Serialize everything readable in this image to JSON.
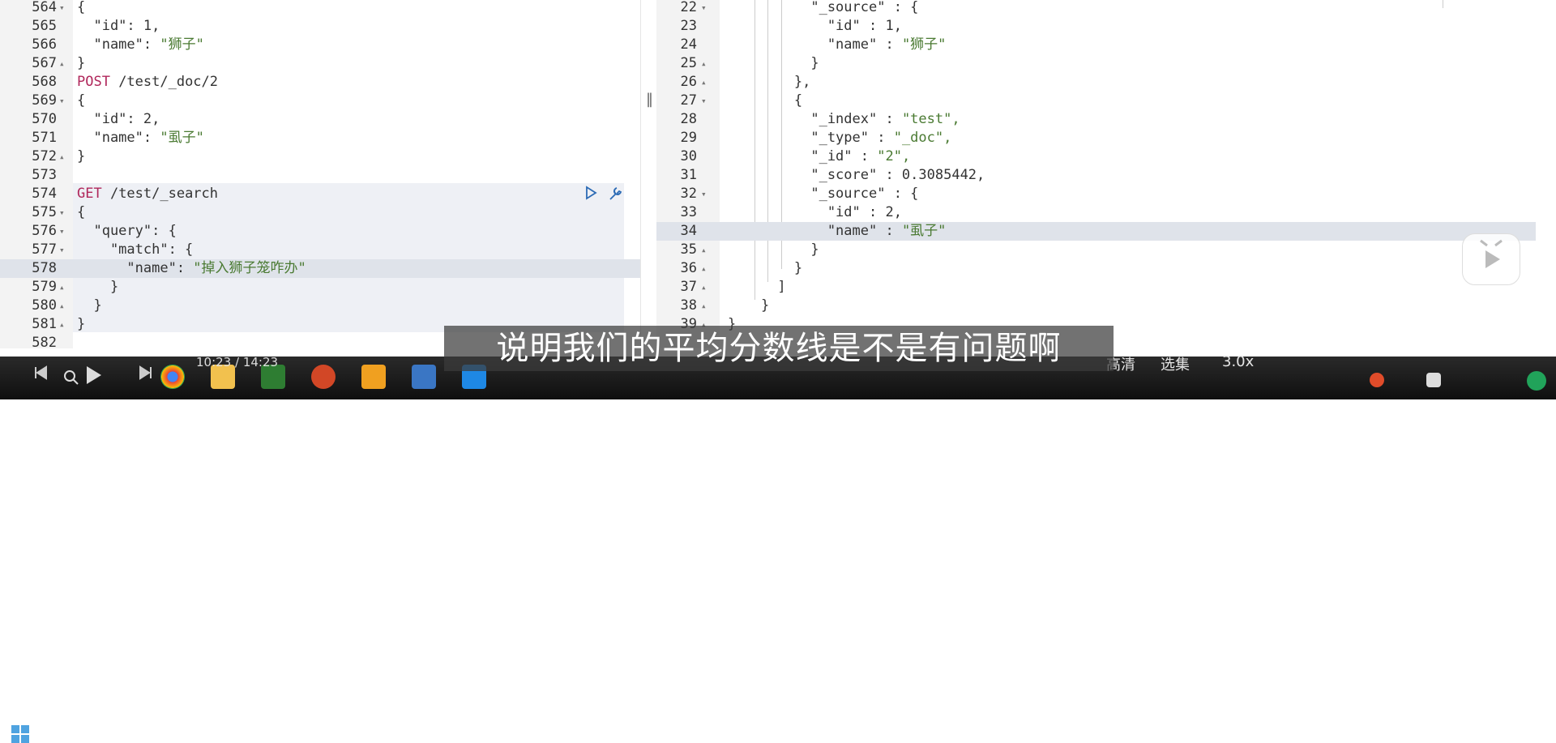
{
  "left_editor": {
    "lines": [
      {
        "num": "564",
        "fold": "▾",
        "code": "{"
      },
      {
        "num": "565",
        "fold": "",
        "code": "  \"id\": 1,"
      },
      {
        "num": "566",
        "fold": "",
        "code": "  \"name\": \"狮子\""
      },
      {
        "num": "567",
        "fold": "▴",
        "code": "}"
      },
      {
        "num": "568",
        "fold": "",
        "method": "POST",
        "url": " /test/_doc/2"
      },
      {
        "num": "569",
        "fold": "▾",
        "code": "{"
      },
      {
        "num": "570",
        "fold": "",
        "code": "  \"id\": 2,"
      },
      {
        "num": "571",
        "fold": "",
        "code": "  \"name\": \"虱子\""
      },
      {
        "num": "572",
        "fold": "▴",
        "code": "}"
      },
      {
        "num": "573",
        "fold": "",
        "code": ""
      },
      {
        "num": "574",
        "fold": "",
        "method": "GET",
        "url": " /test/_search"
      },
      {
        "num": "575",
        "fold": "▾",
        "code": "{"
      },
      {
        "num": "576",
        "fold": "▾",
        "code": "  \"query\": {"
      },
      {
        "num": "577",
        "fold": "▾",
        "code": "    \"match\": {"
      },
      {
        "num": "578",
        "fold": "",
        "code": "      \"name\": \"掉入狮子笼咋办\""
      },
      {
        "num": "579",
        "fold": "▴",
        "code": "    }"
      },
      {
        "num": "580",
        "fold": "▴",
        "code": "  }"
      },
      {
        "num": "581",
        "fold": "▴",
        "code": "}"
      },
      {
        "num": "582",
        "fold": "",
        "code": ""
      }
    ]
  },
  "right_editor": {
    "lines": [
      {
        "num": "22",
        "fold": "▾",
        "code": "          \"_source\" : {"
      },
      {
        "num": "23",
        "fold": "",
        "code": "            \"id\" : 1,"
      },
      {
        "num": "24",
        "fold": "",
        "code": "            \"name\" : \"狮子\""
      },
      {
        "num": "25",
        "fold": "▴",
        "code": "          }"
      },
      {
        "num": "26",
        "fold": "▴",
        "code": "        },"
      },
      {
        "num": "27",
        "fold": "▾",
        "code": "        {"
      },
      {
        "num": "28",
        "fold": "",
        "code": "          \"_index\" : \"test\","
      },
      {
        "num": "29",
        "fold": "",
        "code": "          \"_type\" : \"_doc\","
      },
      {
        "num": "30",
        "fold": "",
        "code": "          \"_id\" : \"2\","
      },
      {
        "num": "31",
        "fold": "",
        "code": "          \"_score\" : 0.3085442,"
      },
      {
        "num": "32",
        "fold": "▾",
        "code": "          \"_source\" : {"
      },
      {
        "num": "33",
        "fold": "",
        "code": "            \"id\" : 2,"
      },
      {
        "num": "34",
        "fold": "",
        "code": "            \"name\" : \"虱子\""
      },
      {
        "num": "35",
        "fold": "▴",
        "code": "          }"
      },
      {
        "num": "36",
        "fold": "▴",
        "code": "        }"
      },
      {
        "num": "37",
        "fold": "▴",
        "code": "      ]"
      },
      {
        "num": "38",
        "fold": "▴",
        "code": "    }"
      },
      {
        "num": "39",
        "fold": "▴",
        "code": "}"
      }
    ]
  },
  "subtitle": "说明我们的平均分数线是不是有问题啊",
  "player": {
    "time": "10:23 / 14:23",
    "quality": "高清",
    "episodes": "选集",
    "speed": "3.0x"
  },
  "colors": {
    "method": "#b0275b",
    "string": "#4a7a32",
    "selection": "#b5d5ee"
  }
}
